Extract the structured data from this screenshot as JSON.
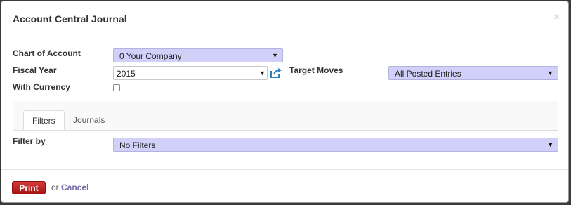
{
  "dialog": {
    "title": "Account Central Journal",
    "close_glyph": "×"
  },
  "form": {
    "chart_of_account": {
      "label": "Chart of Account",
      "value": "0 Your Company"
    },
    "fiscal_year": {
      "label": "Fiscal Year",
      "value": "2015"
    },
    "target_moves": {
      "label": "Target Moves",
      "value": "All Posted Entries"
    },
    "with_currency": {
      "label": "With Currency",
      "checked": false
    },
    "filter_by": {
      "label": "Filter by",
      "value": "No Filters"
    }
  },
  "tabs": [
    {
      "label": "Filters",
      "active": true
    },
    {
      "label": "Journals",
      "active": false
    }
  ],
  "footer": {
    "print_label": "Print",
    "or_text": "or",
    "cancel_label": "Cancel"
  },
  "icons": {
    "caret": "caret-down-icon",
    "external": "external-link-icon"
  },
  "colors": {
    "select_required_bg": "#d0d0f8",
    "print_button": "#b71c1c",
    "cancel_link": "#7b6fae"
  }
}
